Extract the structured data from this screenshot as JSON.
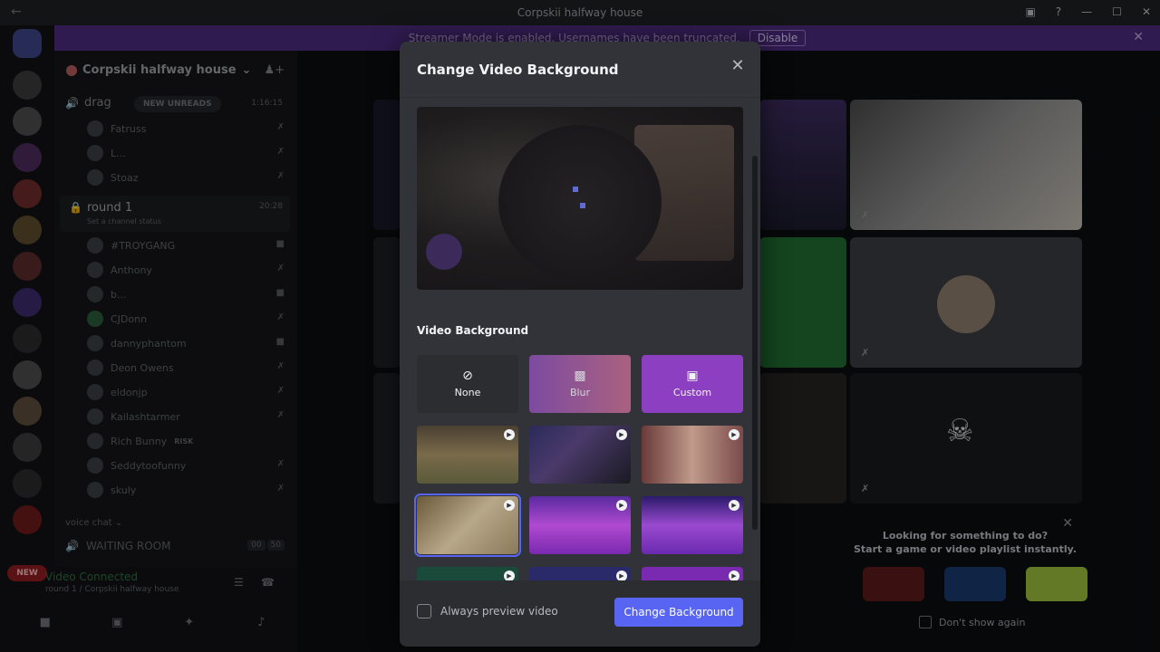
{
  "window": {
    "title": "Corpskii halfway house"
  },
  "banner": {
    "text": "Streamer Mode is enabled. Usernames have been truncated.",
    "disable_label": "Disable"
  },
  "server_rail": {
    "new_badge": "NEW"
  },
  "sidebar": {
    "guild_name": "Corpskii halfway house",
    "drag_channel": {
      "name": "drag",
      "unreads_label": "NEW UNREADS",
      "timer": "1:16:15"
    },
    "drag_users": [
      "Fatruss",
      "L...",
      "Stoaz"
    ],
    "round1": {
      "name": "round 1",
      "status": "Set a channel status",
      "timer": "20:28"
    },
    "round1_users": [
      {
        "name": "#TROYGANG"
      },
      {
        "name": "Anthony"
      },
      {
        "name": "b..."
      },
      {
        "name": "CJDonn"
      },
      {
        "name": "dannyphantom"
      },
      {
        "name": "Deon Owens"
      },
      {
        "name": "eldonjp"
      },
      {
        "name": "Kailashtarmer"
      },
      {
        "name": "Rich Bunny",
        "badge": "RISK"
      },
      {
        "name": "Seddytoofunny"
      },
      {
        "name": "skuly"
      }
    ],
    "category": "voice chat",
    "waiting_room": {
      "name": "WAITING ROOM",
      "count_a": "00",
      "count_b": "50"
    },
    "voice_panel": {
      "status": "Video Connected",
      "location": "round 1 / Corpskii halfway house"
    }
  },
  "promo": {
    "line1": "Looking for something to do?",
    "line2": "Start a game or video playlist instantly.",
    "dont_show": "Don't show again"
  },
  "modal": {
    "title": "Change Video Background",
    "section_label": "Video Background",
    "options": {
      "none": "None",
      "blur": "Blur",
      "custom": "Custom"
    },
    "always_preview": "Always preview video",
    "change_button": "Change Background"
  }
}
